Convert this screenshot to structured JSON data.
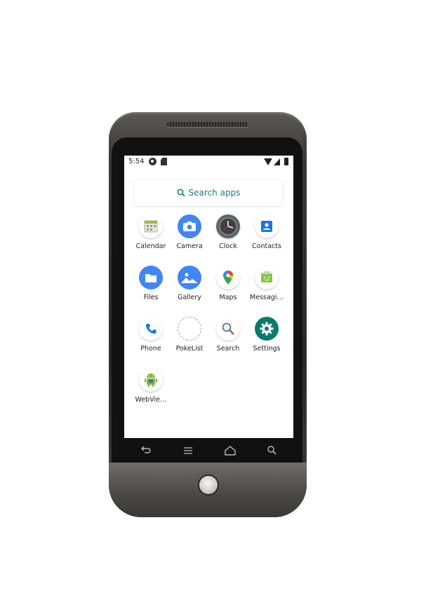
{
  "status_bar": {
    "time": "5:54"
  },
  "search": {
    "label": "Search apps"
  },
  "apps": [
    {
      "label": "Calendar",
      "icon": "calendar-icon"
    },
    {
      "label": "Camera",
      "icon": "camera-icon"
    },
    {
      "label": "Clock",
      "icon": "clock-icon"
    },
    {
      "label": "Contacts",
      "icon": "contacts-icon"
    },
    {
      "label": "Files",
      "icon": "files-icon"
    },
    {
      "label": "Gallery",
      "icon": "gallery-icon"
    },
    {
      "label": "Maps",
      "icon": "maps-icon"
    },
    {
      "label": "Messagi…",
      "icon": "messaging-icon"
    },
    {
      "label": "Phone",
      "icon": "phone-icon"
    },
    {
      "label": "PokeList",
      "icon": "pokelist-icon"
    },
    {
      "label": "Search",
      "icon": "search-app-icon"
    },
    {
      "label": "Settings",
      "icon": "settings-icon"
    },
    {
      "label": "WebVie…",
      "icon": "webview-icon"
    }
  ],
  "nav": [
    "back-icon",
    "menu-icon",
    "home-icon",
    "search-icon"
  ],
  "colors": {
    "accent": "#1c7f73",
    "settings": "#0b7a6e",
    "camera": "#4285f4",
    "files": "#4285f4",
    "gallery": "#4285f4"
  }
}
